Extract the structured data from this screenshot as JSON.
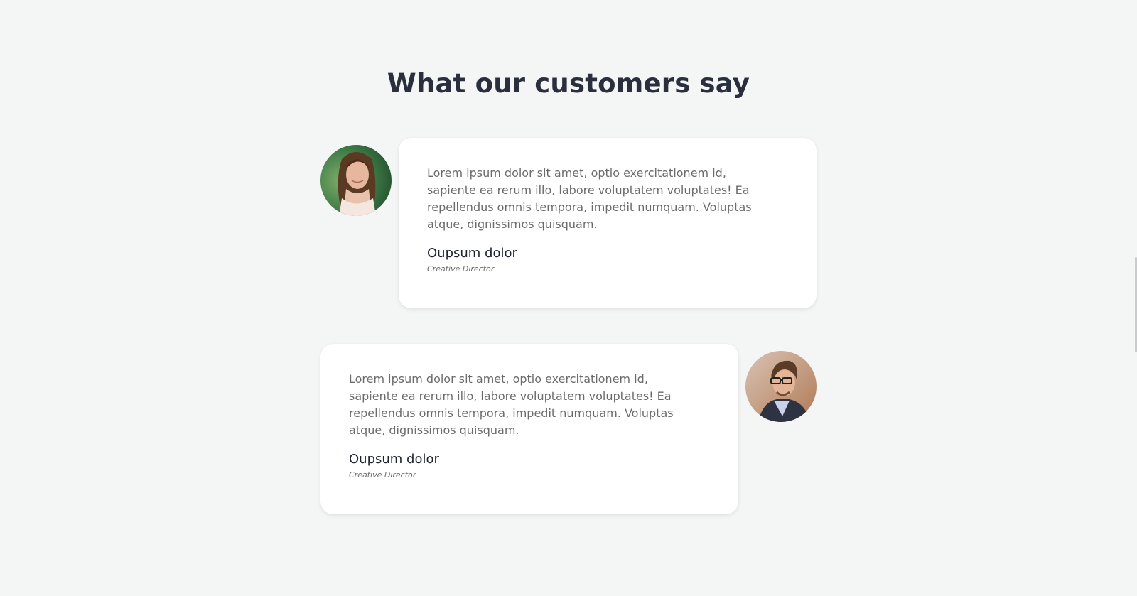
{
  "section": {
    "title": "What our customers say"
  },
  "testimonials": [
    {
      "quote": "Lorem ipsum dolor sit amet, optio exercitationem id, sapiente ea rerum illo, labore voluptatem voluptates! Ea repellendus omnis tempora, impedit numquam. Voluptas atque, dignissimos quisquam.",
      "name": "Oupsum dolor",
      "role": "Creative Director",
      "avatar_icon": "woman-portrait"
    },
    {
      "quote": "Lorem ipsum dolor sit amet, optio exercitationem id, sapiente ea rerum illo, labore voluptatem voluptates! Ea repellendus omnis tempora, impedit numquam. Voluptas atque, dignissimos quisquam.",
      "name": "Oupsum dolor",
      "role": "Creative Director",
      "avatar_icon": "man-portrait"
    }
  ],
  "colors": {
    "background": "#f4f5f5",
    "card": "#ffffff",
    "title": "#2a2f3e",
    "body_text": "#6b6b6b"
  }
}
